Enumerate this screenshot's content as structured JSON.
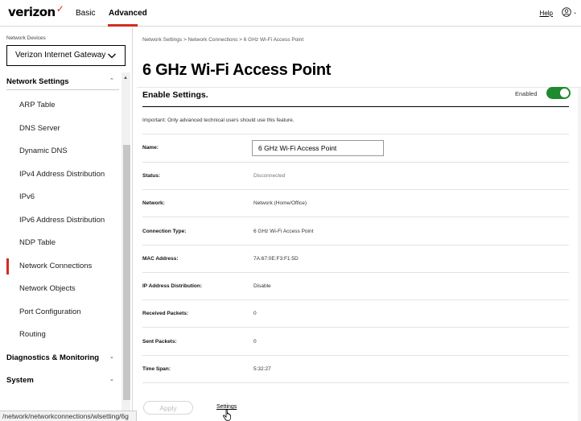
{
  "header": {
    "logo": "verizon",
    "tabs": [
      {
        "label": "Basic",
        "active": false
      },
      {
        "label": "Advanced",
        "active": true
      }
    ],
    "help_label": "Help",
    "user_icon": "user-circle-icon",
    "accent_color": "#d52b1e"
  },
  "sidebar": {
    "devices_label": "Network Devices",
    "device_selected": "Verizon Internet Gateway",
    "sections": {
      "network_settings": "Network Settings",
      "diagnostics": "Diagnostics & Monitoring",
      "system": "System"
    },
    "items": [
      {
        "label": "ARP Table"
      },
      {
        "label": "DNS Server"
      },
      {
        "label": "Dynamic DNS"
      },
      {
        "label": "IPv4 Address Distribution"
      },
      {
        "label": "IPv6"
      },
      {
        "label": "IPv6 Address Distribution"
      },
      {
        "label": "NDP Table"
      },
      {
        "label": "Network Connections",
        "active": true
      },
      {
        "label": "Network Objects"
      },
      {
        "label": "Port Configuration"
      },
      {
        "label": "Routing"
      }
    ]
  },
  "status_url": "/network/networkconnections/wlsetting/6g",
  "main": {
    "breadcrumb": {
      "part1": "Network Settings",
      "part2": "Network Connections",
      "part3": "6 GHz Wi-Fi Access Point",
      "separator": ">"
    },
    "title": "6 GHz Wi-Fi Access Point",
    "enable_title": "Enable Settings.",
    "enabled_label": "Enabled",
    "enabled": true,
    "toggle_color": "#1f8a2f",
    "important_note": "Important: Only advanced technical users should use this feature.",
    "rows": [
      {
        "label": "Name:",
        "value": "6 GHz Wi-Fi Access Point"
      },
      {
        "label": "Status:",
        "value": "Disconnected"
      },
      {
        "label": "Network:",
        "value": "Network (Home/Office)"
      },
      {
        "label": "Connection Type:",
        "value": "6 GHz Wi-Fi Access Point"
      },
      {
        "label": "MAC Address:",
        "value": "7A:67:0E:F3:F1:5D"
      },
      {
        "label": "IP Address Distribution:",
        "value": "Disable"
      },
      {
        "label": "Received Packets:",
        "value": "0"
      },
      {
        "label": "Sent Packets:",
        "value": "0"
      },
      {
        "label": "Time Span:",
        "value": "5:32:27"
      }
    ],
    "apply_label": "Apply",
    "settings_label": "Settings"
  }
}
